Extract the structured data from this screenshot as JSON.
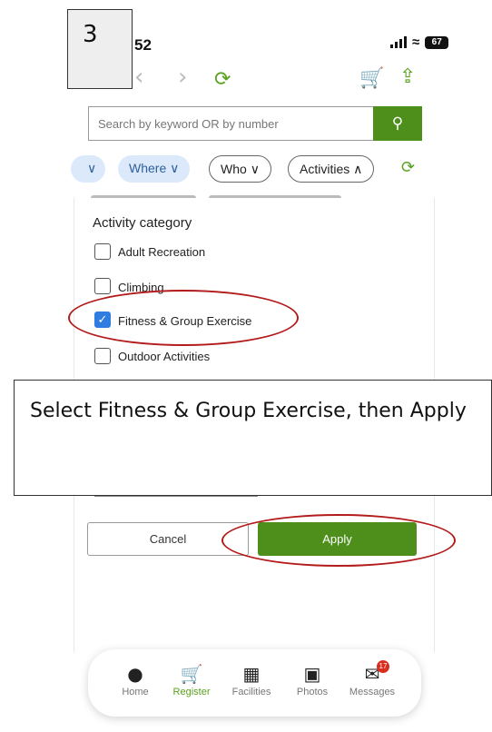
{
  "step": {
    "number": "3"
  },
  "status_bar": {
    "time": "52",
    "battery": "67"
  },
  "search": {
    "placeholder": "Search by keyword OR by number"
  },
  "filters": {
    "chips": [
      {
        "label": "Where"
      },
      {
        "label": "Who"
      },
      {
        "label": "Activities"
      }
    ]
  },
  "activity_panel": {
    "title": "Activity category",
    "options": [
      {
        "label": "Adult Recreation",
        "checked": false
      },
      {
        "label": "Climbing",
        "checked": false
      },
      {
        "label": "Fitness & Group Exercise",
        "checked": true
      },
      {
        "label": "Outdoor Activities",
        "checked": false
      }
    ],
    "cancel_label": "Cancel",
    "apply_label": "Apply"
  },
  "annotation": {
    "instruction": "Select Fitness & Group Exercise, then Apply"
  },
  "tabbar": {
    "items": [
      {
        "label": "Home",
        "icon": "person-icon"
      },
      {
        "label": "Register",
        "icon": "cart-icon"
      },
      {
        "label": "Facilities",
        "icon": "building-icon"
      },
      {
        "label": "Photos",
        "icon": "photos-icon"
      },
      {
        "label": "Messages",
        "icon": "mail-icon"
      }
    ],
    "messages_badge": "17"
  },
  "colors": {
    "accent_green": "#4e8f1c",
    "chip_blue": "#dbe9fb",
    "checkbox_blue": "#2f7de1",
    "highlight_red": "#b31b1b"
  }
}
